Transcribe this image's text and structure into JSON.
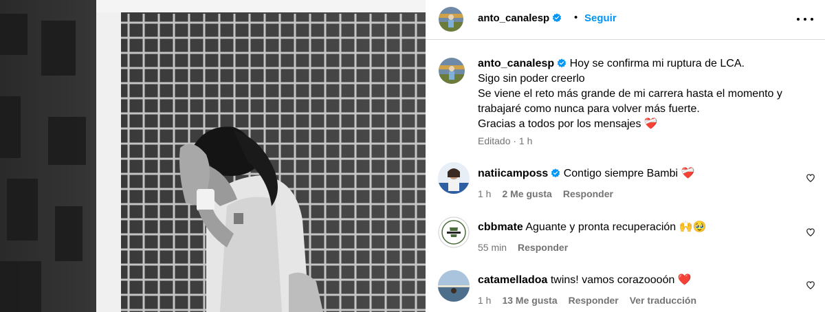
{
  "header": {
    "username": "anto_canalesp",
    "dot": "•",
    "follow_label": "Seguir"
  },
  "caption": {
    "username": "anto_canalesp",
    "lines": [
      "Hoy se confirma mi ruptura de LCA.",
      "Sigo sin poder creerlo",
      "Se viene el reto más grande de mi carrera hasta el momento y",
      "trabajaré como nunca para volver más fuerte.",
      "Gracias a todos por los mensajes ❤️‍🩹"
    ],
    "meta": "Editado · 1 h"
  },
  "comments": [
    {
      "username": "natiicamposs",
      "verified": true,
      "text": "Contigo siempre Bambi ❤️‍🩹",
      "time": "1 h",
      "likes": "2 Me gusta",
      "reply": "Responder",
      "translate": ""
    },
    {
      "username": "cbbmate",
      "verified": false,
      "text": "Aguante y pronta recuperación 🙌🥹",
      "time": "55 min",
      "likes": "",
      "reply": "Responder",
      "translate": ""
    },
    {
      "username": "catamelladoa",
      "verified": false,
      "text": "twins! vamos corazoooón ❤️",
      "time": "1 h",
      "likes": "13 Me gusta",
      "reply": "Responder",
      "translate": "Ver traducción"
    }
  ],
  "icons": {
    "verified": "verified-badge-icon",
    "more": "more-options-icon",
    "like": "heart-outline-icon"
  },
  "colors": {
    "link": "#0095f6",
    "verified": "#0095f6",
    "muted": "#737373"
  }
}
